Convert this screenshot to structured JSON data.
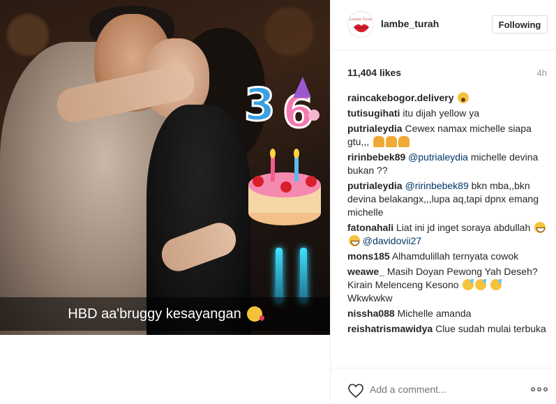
{
  "photo": {
    "caption_text": "HBD aa'bruggy kesayangan",
    "caption_emoji": "kissing-face-emoji",
    "stickers": [
      "36-sticker",
      "birthday-cake-sticker"
    ]
  },
  "post": {
    "username": "lambe_turah",
    "avatar_icon": "red-lips-logo",
    "follow_label": "Following",
    "likes": "11,404 likes",
    "time_ago": "4h"
  },
  "comments": [
    {
      "user": "raincakebogor.delivery",
      "text": "",
      "emoji": [
        "shock"
      ]
    },
    {
      "user": "tutisugihati",
      "text": "itu dijah yellow ya"
    },
    {
      "user": "putrialeydia",
      "text": "Cewex namax michelle siapa gtu,,,",
      "emoji": [
        "pray",
        "pray",
        "pray"
      ]
    },
    {
      "user": "ririnbebek89",
      "mention": "@putrialeydia",
      "text": "michelle devina bukan ??"
    },
    {
      "user": "putrialeydia",
      "mention": "@ririnbebek89",
      "text": "bkn mba,,bkn devina belakangx,,,lupa aq,tapi dpnx emang michelle"
    },
    {
      "user": "fatonahali",
      "text": "Liat ini jd inget soraya abdullah",
      "emoji": [
        "grin",
        "grin"
      ],
      "mention_after": "@davidovii27"
    },
    {
      "user": "mons185",
      "text": "Alhamdulillah ternyata cowok"
    },
    {
      "user": "weawe_",
      "text": "Masih Doyan Pewong Yah Deseh? Kirain Melenceng Kesono",
      "emoji": [
        "sweat",
        "sweat",
        "sweat"
      ],
      "text_after": "Wkwkwkw"
    },
    {
      "user": "nissha088",
      "text": "Michelle amanda"
    },
    {
      "user": "reishatrismawidya",
      "text": "Clue sudah mulai terbuka"
    }
  ],
  "footer": {
    "comment_placeholder": "Add a comment...",
    "like_icon": "heart-outline-icon",
    "more_icon": "more-options-icon"
  },
  "colors": {
    "link": "#003569",
    "muted": "#999999",
    "border": "#efefef",
    "text": "#262626"
  }
}
